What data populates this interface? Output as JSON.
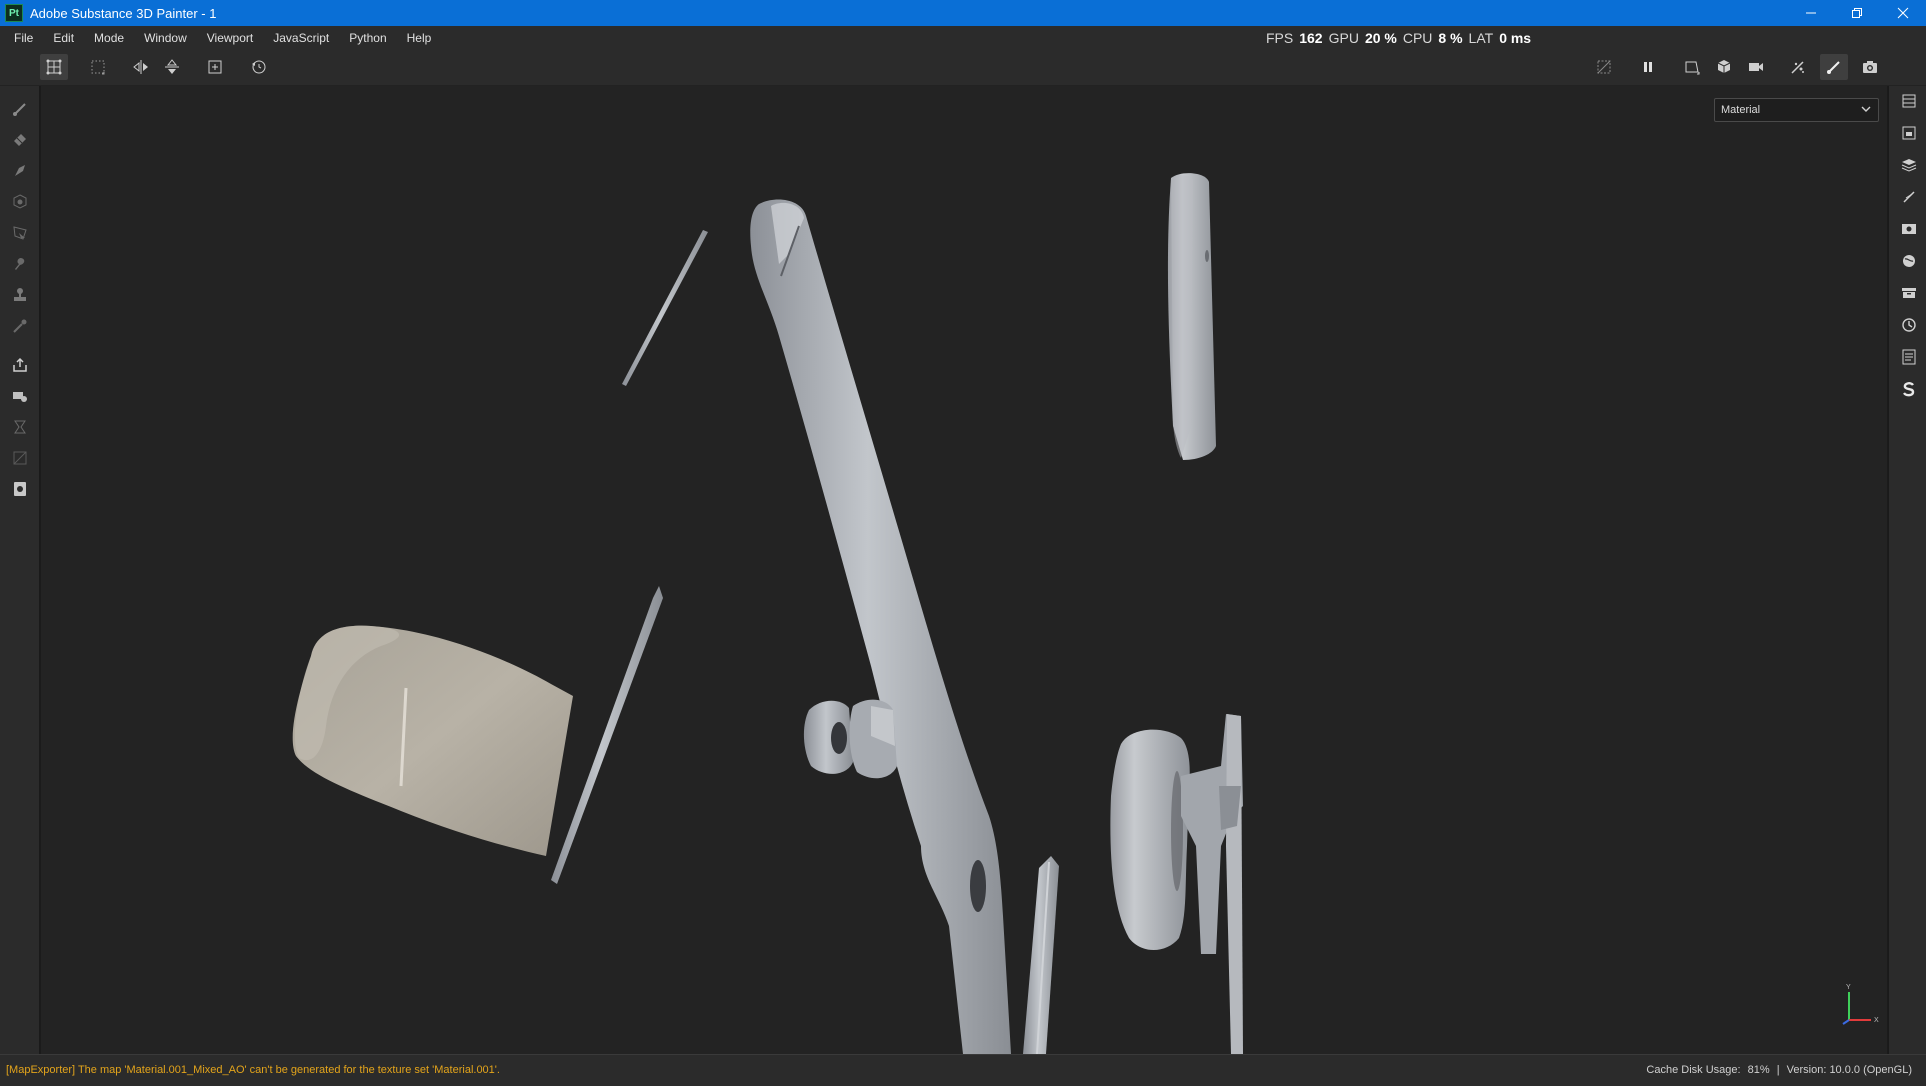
{
  "window": {
    "app_logo": "Pt",
    "title": "Adobe Substance 3D Painter - 1",
    "minimize_icon": "minimize-icon",
    "restore_icon": "restore-icon",
    "close_icon": "close-icon"
  },
  "menu": {
    "items": [
      "File",
      "Edit",
      "Mode",
      "Window",
      "Viewport",
      "JavaScript",
      "Python",
      "Help"
    ]
  },
  "stats": {
    "fps_label": "FPS",
    "fps_value": "162",
    "gpu_label": "GPU",
    "gpu_value": "20 %",
    "cpu_label": "CPU",
    "cpu_value": "8 %",
    "lat_label": "LAT",
    "lat_value": "0 ms"
  },
  "toolbar": {
    "left_icons": [
      "quad-select-icon",
      "dotted-select-icon",
      "mirror-x-icon",
      "mirror-y-icon",
      "add-frame-icon",
      "reset-icon"
    ],
    "right_icons": [
      "hide-grid-icon",
      "pause-icon",
      "camera-frame-icon",
      "cube-icon",
      "video-camera-icon",
      "particles-icon",
      "brush-mode-icon",
      "screenshot-icon"
    ]
  },
  "left_tools": [
    "paint-brush-icon",
    "eraser-icon",
    "projection-icon",
    "geometry-fill-icon",
    "polygon-fill-icon",
    "smudge-icon",
    "clone-stamp-icon",
    "color-picker-icon",
    "export-icon",
    "bake-icon",
    "iray-icon",
    "uv-icon",
    "settings-icon"
  ],
  "right_docks": [
    "texture-sets-icon",
    "texture-set-settings-icon",
    "layers-icon",
    "properties-icon",
    "display-settings-icon",
    "environment-icon",
    "shelf-icon",
    "history-icon",
    "log-icon",
    "substance-icon"
  ],
  "viewport": {
    "mode_select": "Material",
    "axis_y": "Y",
    "axis_x": "X"
  },
  "status": {
    "message": "[MapExporter] The map 'Material.001_Mixed_AO' can't be generated for the texture set 'Material.001'.",
    "cache_label": "Cache Disk Usage:",
    "cache_value": "81%",
    "separator": "|",
    "version": "Version: 10.0.0 (OpenGL)"
  },
  "colors": {
    "title_bar": "#0a6fd6",
    "panel": "#2b2b2b",
    "viewport": "#232323",
    "warning_text": "#e3a41b",
    "model_metal": "#a9adb2",
    "model_beige": "#b0aa9e"
  }
}
